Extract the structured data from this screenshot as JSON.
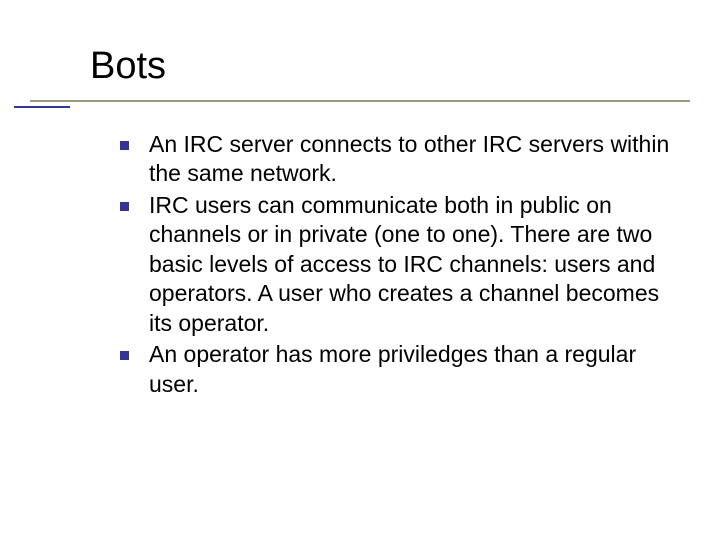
{
  "title": "Bots",
  "bullets": [
    "An IRC server connects to other IRC servers within the same network.",
    "IRC users can communicate both in public on channels or in private (one to one). There are two basic levels of access to IRC channels: users and operators. A user who creates a channel becomes its operator.",
    "An operator has more priviledges than a regular user."
  ]
}
